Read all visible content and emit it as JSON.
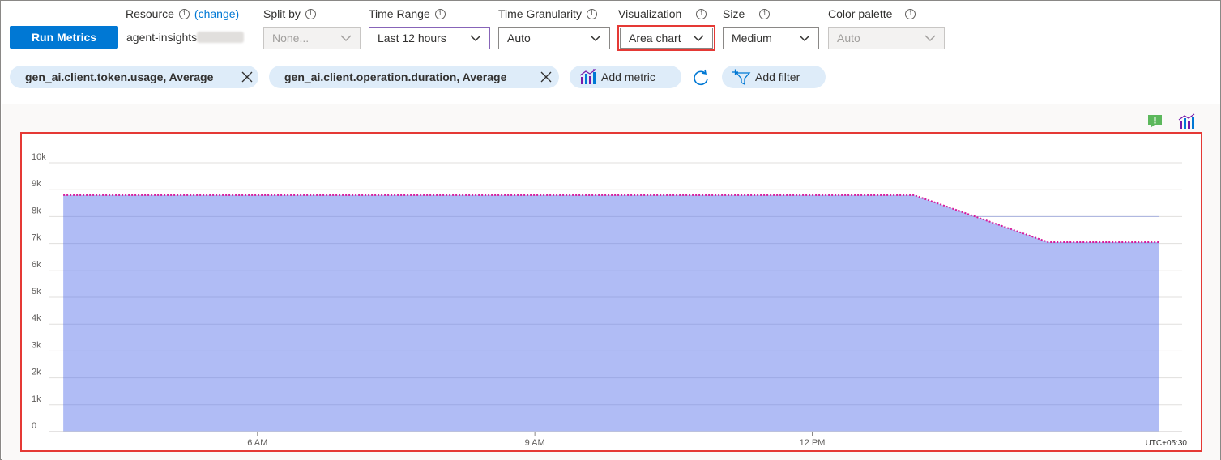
{
  "toolbar": {
    "run_label": "Run Metrics",
    "resource_label": "Resource",
    "change_link": "(change)",
    "resource_value": "agent-insights",
    "split_by_label": "Split by",
    "split_by_value": "None...",
    "time_range_label": "Time Range",
    "time_range_value": "Last 12 hours",
    "granularity_label": "Time Granularity",
    "granularity_value": "Auto",
    "visualization_label": "Visualization",
    "visualization_value": "Area chart",
    "size_label": "Size",
    "size_value": "Medium",
    "palette_label": "Color palette",
    "palette_value": "Auto",
    "info_glyph": "i"
  },
  "metrics": {
    "chips": [
      {
        "label": "gen_ai.client.token.usage, Average"
      },
      {
        "label": "gen_ai.client.operation.duration, Average"
      }
    ],
    "add_metric_label": "Add metric",
    "add_filter_label": "Add filter"
  },
  "icons": {
    "feedback": "feedback-icon",
    "chart_settings": "chart-settings-icon"
  },
  "colors": {
    "primary": "#0078d4",
    "highlight": "#e53935",
    "area_fill": "#b0bcf5",
    "series_line": "#d81b9a",
    "chip_bg": "#deecf9",
    "feedback_green": "#5cb85c"
  },
  "chart_data": {
    "type": "area",
    "y_tick_labels": [
      "0",
      "1k",
      "2k",
      "3k",
      "4k",
      "5k",
      "6k",
      "7k",
      "8k",
      "9k",
      "10k"
    ],
    "ylim": [
      0,
      10000
    ],
    "x_tick_labels": [
      "6 AM",
      "9 AM",
      "12 PM"
    ],
    "x_tick_hours": [
      6,
      9,
      12
    ],
    "xlim_hours": [
      3.75,
      16.0
    ],
    "timezone_label": "UTC+05:30",
    "grid": true,
    "series": [
      {
        "x_hours": [
          3.9,
          13.1,
          14.55,
          15.75
        ],
        "values": [
          8800,
          8800,
          7050,
          7050
        ]
      }
    ]
  }
}
